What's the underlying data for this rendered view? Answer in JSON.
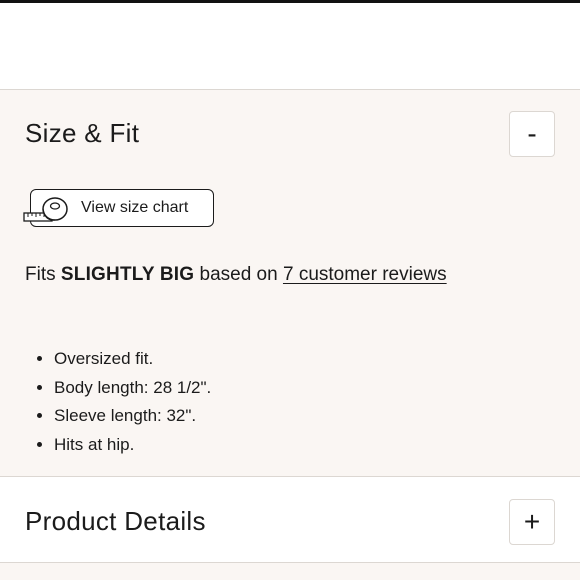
{
  "size_fit": {
    "title": "Size & Fit",
    "toggle_label": "-",
    "size_chart_button": "View size chart",
    "fit_prefix": "Fits",
    "fit_value": "SLIGHTLY BIG",
    "fit_middle": "based on",
    "reviews_link": "7 customer reviews",
    "bullets": [
      "Oversized fit.",
      "Body length: 28 1/2\".",
      "Sleeve length: 32\".",
      "Hits at hip."
    ]
  },
  "product_details": {
    "title": "Product Details",
    "toggle_label": "+"
  }
}
